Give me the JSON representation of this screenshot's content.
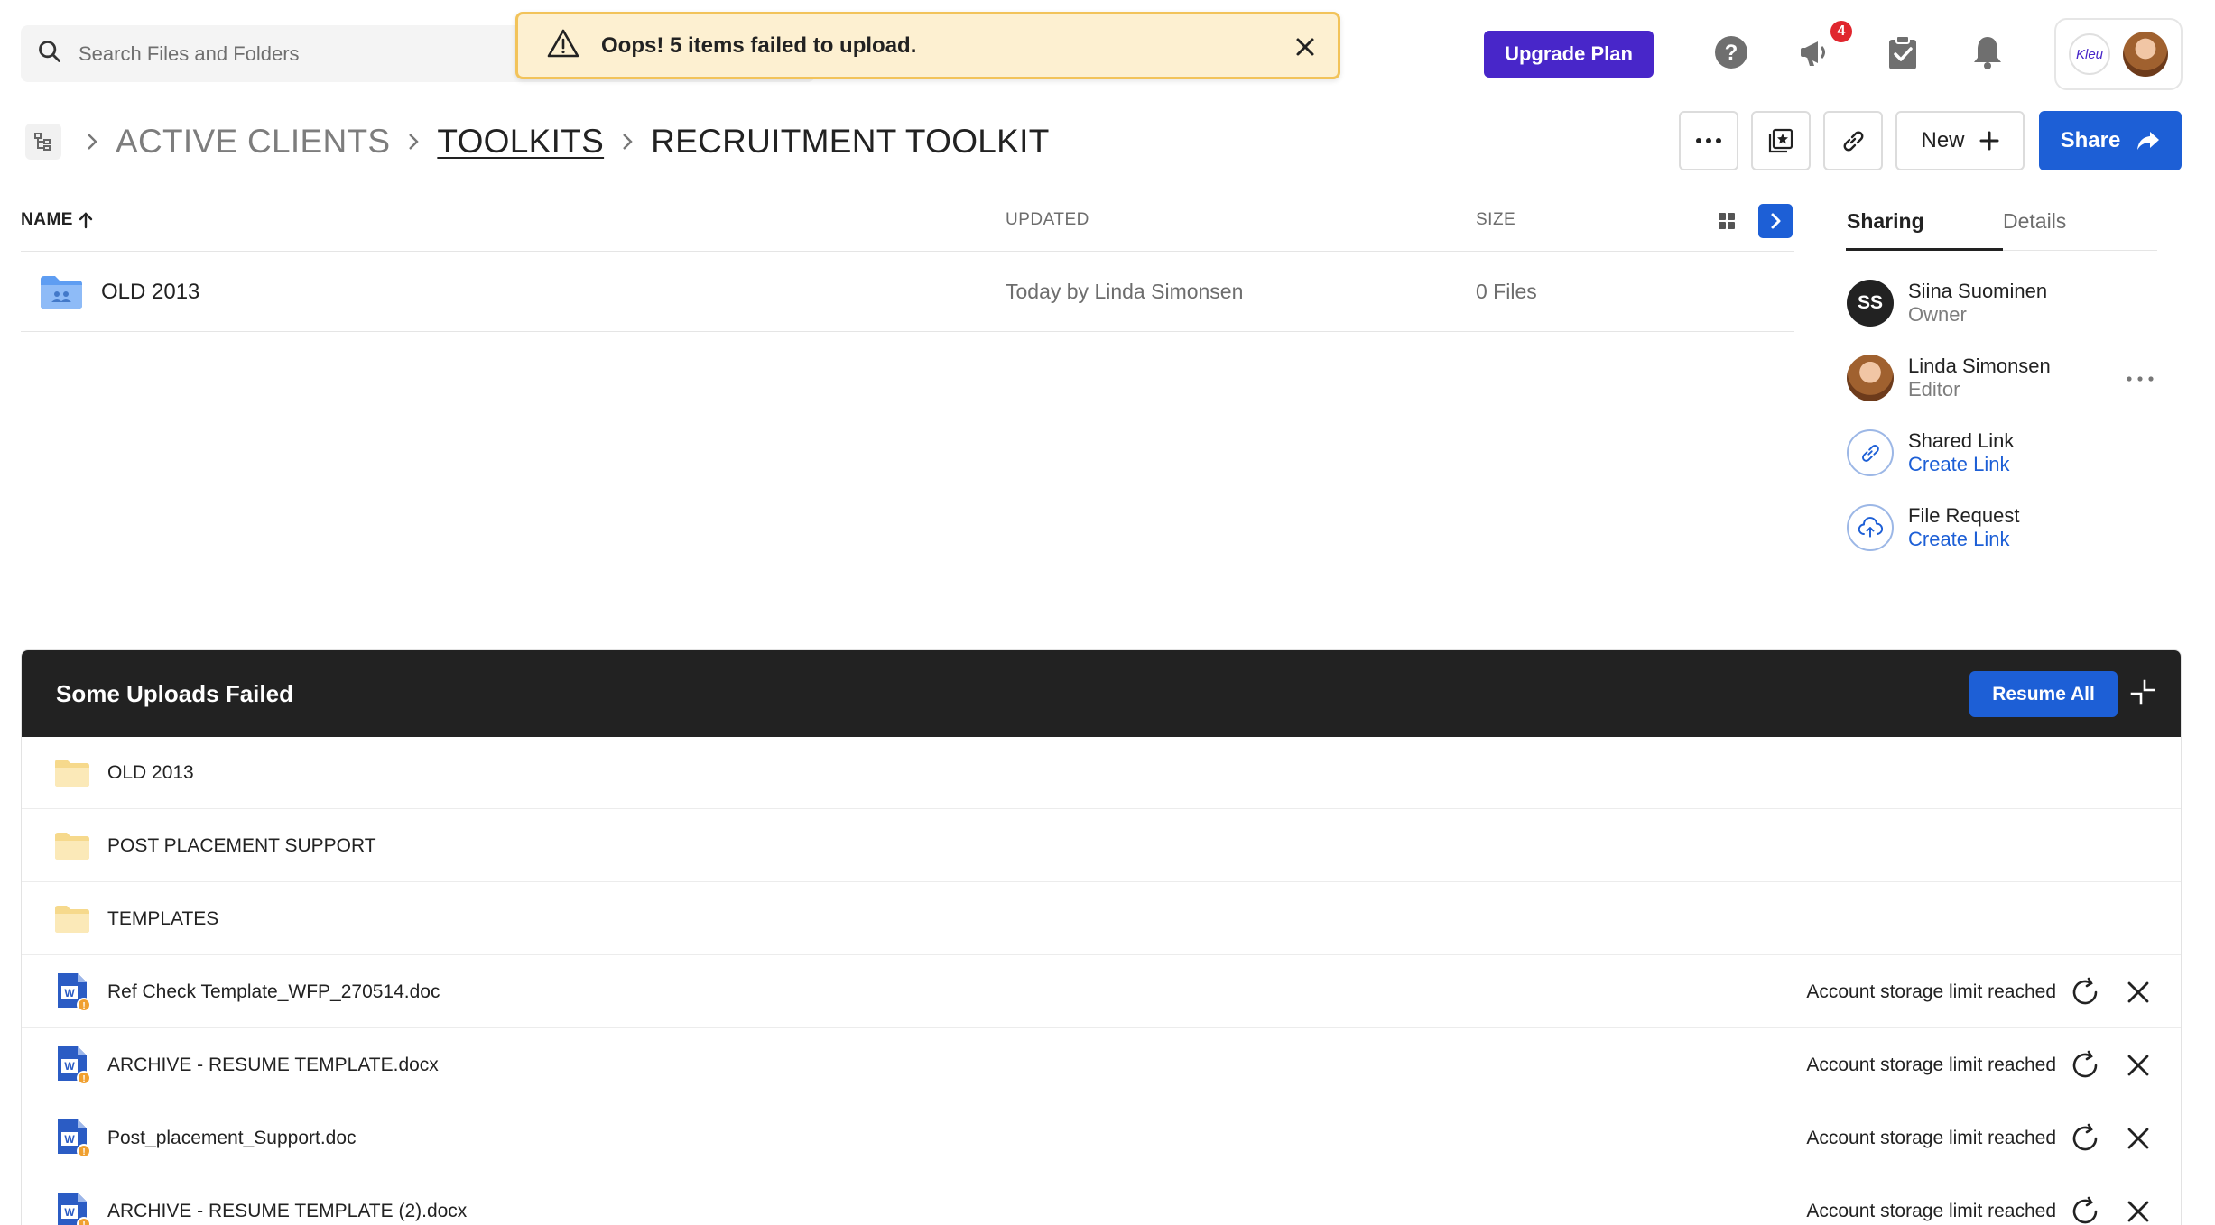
{
  "search": {
    "placeholder": "Search Files and Folders"
  },
  "toast": {
    "message": "Oops! 5 items failed to upload."
  },
  "header": {
    "upgrade_label": "Upgrade Plan",
    "notification_count": "4",
    "account_logo_text": "Kleu"
  },
  "breadcrumb": {
    "items": [
      "ACTIVE CLIENTS",
      "TOOLKITS",
      "RECRUITMENT TOOLKIT"
    ]
  },
  "toolbar": {
    "new_label": "New",
    "share_label": "Share"
  },
  "table": {
    "headers": {
      "name": "NAME",
      "updated": "UPDATED",
      "size": "SIZE"
    },
    "rows": [
      {
        "name": "OLD 2013",
        "updated": "Today by Linda Simonsen",
        "size": "0 Files",
        "type": "shared-folder"
      }
    ]
  },
  "sidebar": {
    "tabs": [
      "Sharing",
      "Details"
    ],
    "active_tab": "Sharing",
    "people": [
      {
        "initials": "SS",
        "name": "Siina Suominen",
        "role": "Owner"
      },
      {
        "name": "Linda Simonsen",
        "role": "Editor"
      }
    ],
    "shared_link": {
      "title": "Shared Link",
      "action": "Create Link"
    },
    "file_request": {
      "title": "File Request",
      "action": "Create Link"
    }
  },
  "uploads": {
    "title": "Some Uploads Failed",
    "resume_label": "Resume All",
    "items": [
      {
        "name": "OLD 2013",
        "type": "folder",
        "status": ""
      },
      {
        "name": "POST PLACEMENT SUPPORT",
        "type": "folder",
        "status": ""
      },
      {
        "name": "TEMPLATES",
        "type": "folder",
        "status": ""
      },
      {
        "name": "Ref Check Template_WFP_270514.doc",
        "type": "word-doc",
        "status": "Account storage limit reached"
      },
      {
        "name": "ARCHIVE - RESUME TEMPLATE.docx",
        "type": "word-doc",
        "status": "Account storage limit reached"
      },
      {
        "name": "Post_placement_Support.doc",
        "type": "word-doc",
        "status": "Account storage limit reached"
      },
      {
        "name": "ARCHIVE - RESUME TEMPLATE (2).docx",
        "type": "word-doc",
        "status": "Account storage limit reached"
      }
    ]
  },
  "colors": {
    "accent_blue": "#1d5fd6",
    "upgrade_purple": "#4826c9",
    "toast_bg": "#fdf0d1",
    "toast_border": "#f2c35a",
    "badge_red": "#e0262e",
    "panel_header": "#222222"
  }
}
